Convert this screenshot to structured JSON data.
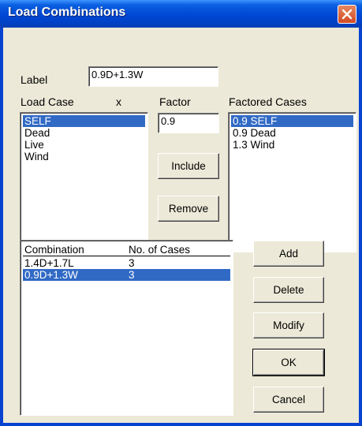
{
  "window": {
    "title": "Load Combinations"
  },
  "label_field": {
    "label": "Label",
    "value": "0.9D+1.3W"
  },
  "load_case": {
    "header": "Load Case",
    "x_header": "x",
    "items": [
      "SELF",
      "Dead",
      "Live",
      "Wind"
    ],
    "selected": "SELF"
  },
  "factor": {
    "header": "Factor",
    "value": "0.9"
  },
  "factored_cases": {
    "header": "Factored Cases",
    "items": [
      "0.9 SELF",
      "0.9 Dead",
      "1.3 Wind"
    ],
    "selected": "0.9 SELF"
  },
  "buttons": {
    "include": "Include",
    "remove": "Remove",
    "add": "Add",
    "delete": "Delete",
    "modify": "Modify",
    "ok": "OK",
    "cancel": "Cancel"
  },
  "combinations": {
    "columns": [
      "Combination",
      "No. of Cases"
    ],
    "rows": [
      [
        "1.4D+1.7L",
        "3"
      ],
      [
        "0.9D+1.3W",
        "3"
      ]
    ],
    "selected_row": "0.9D+1.3W"
  },
  "colors": {
    "selection": "#316ac5",
    "dialog_bg": "#ece9d8",
    "titlebar": "#0047d4"
  }
}
